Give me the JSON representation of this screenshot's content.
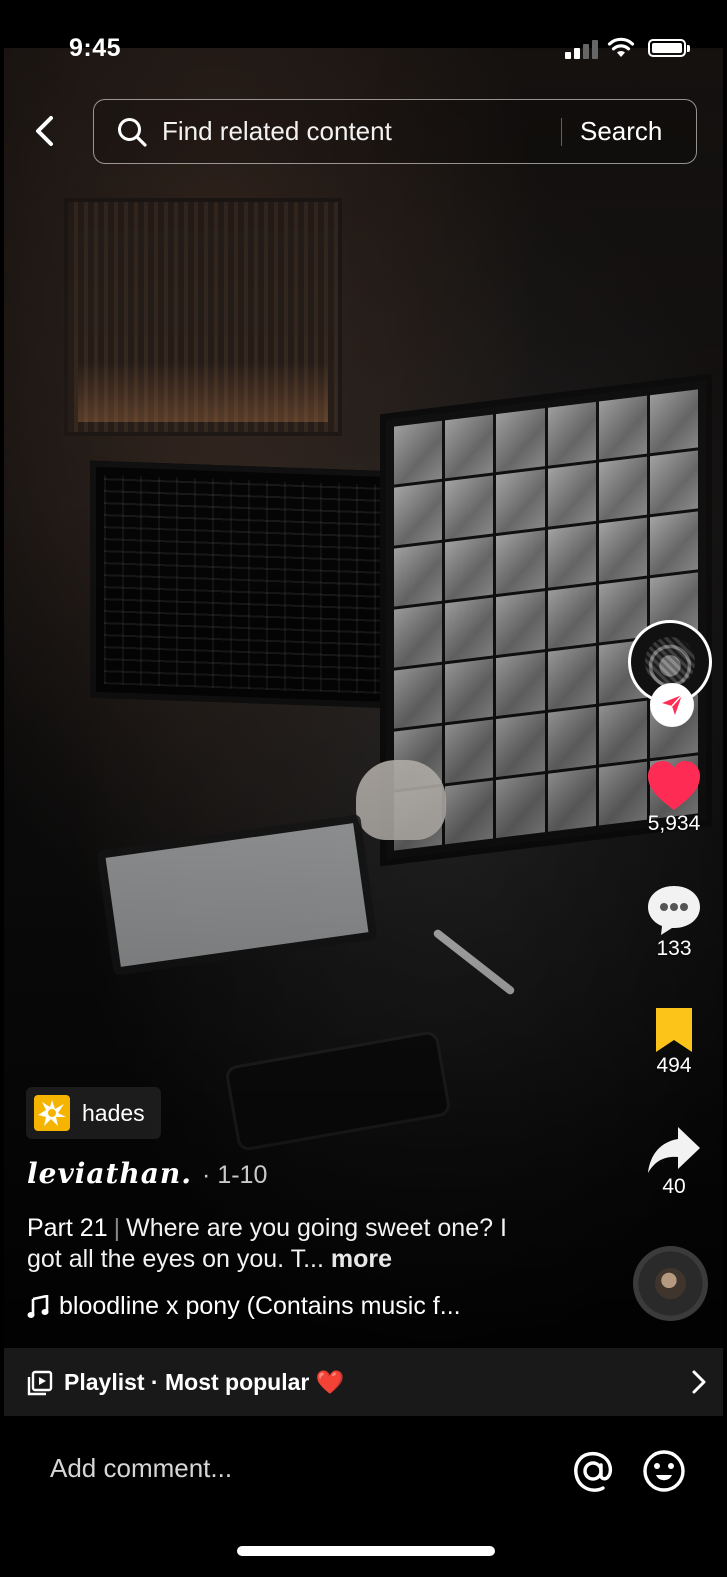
{
  "status_bar": {
    "time": "9:45"
  },
  "search": {
    "placeholder": "Find related content",
    "button_label": "Search"
  },
  "rail": {
    "likes": "5,934",
    "comments": "133",
    "saves": "494",
    "shares": "40",
    "like_color": "#fe2c55",
    "save_color": "#fcc419"
  },
  "video": {
    "tag_label": "hades",
    "author": "leviathan.",
    "author_suffix": "· 1-10",
    "caption_part": "Part 21",
    "caption_text": "Where are you going sweet one? I got all the eyes on you. T...",
    "caption_more": "more",
    "sound": "bloodline x pony (Contains music f..."
  },
  "playlist": {
    "label": "Playlist · Most popular ❤️"
  },
  "comment": {
    "placeholder": "Add comment..."
  }
}
